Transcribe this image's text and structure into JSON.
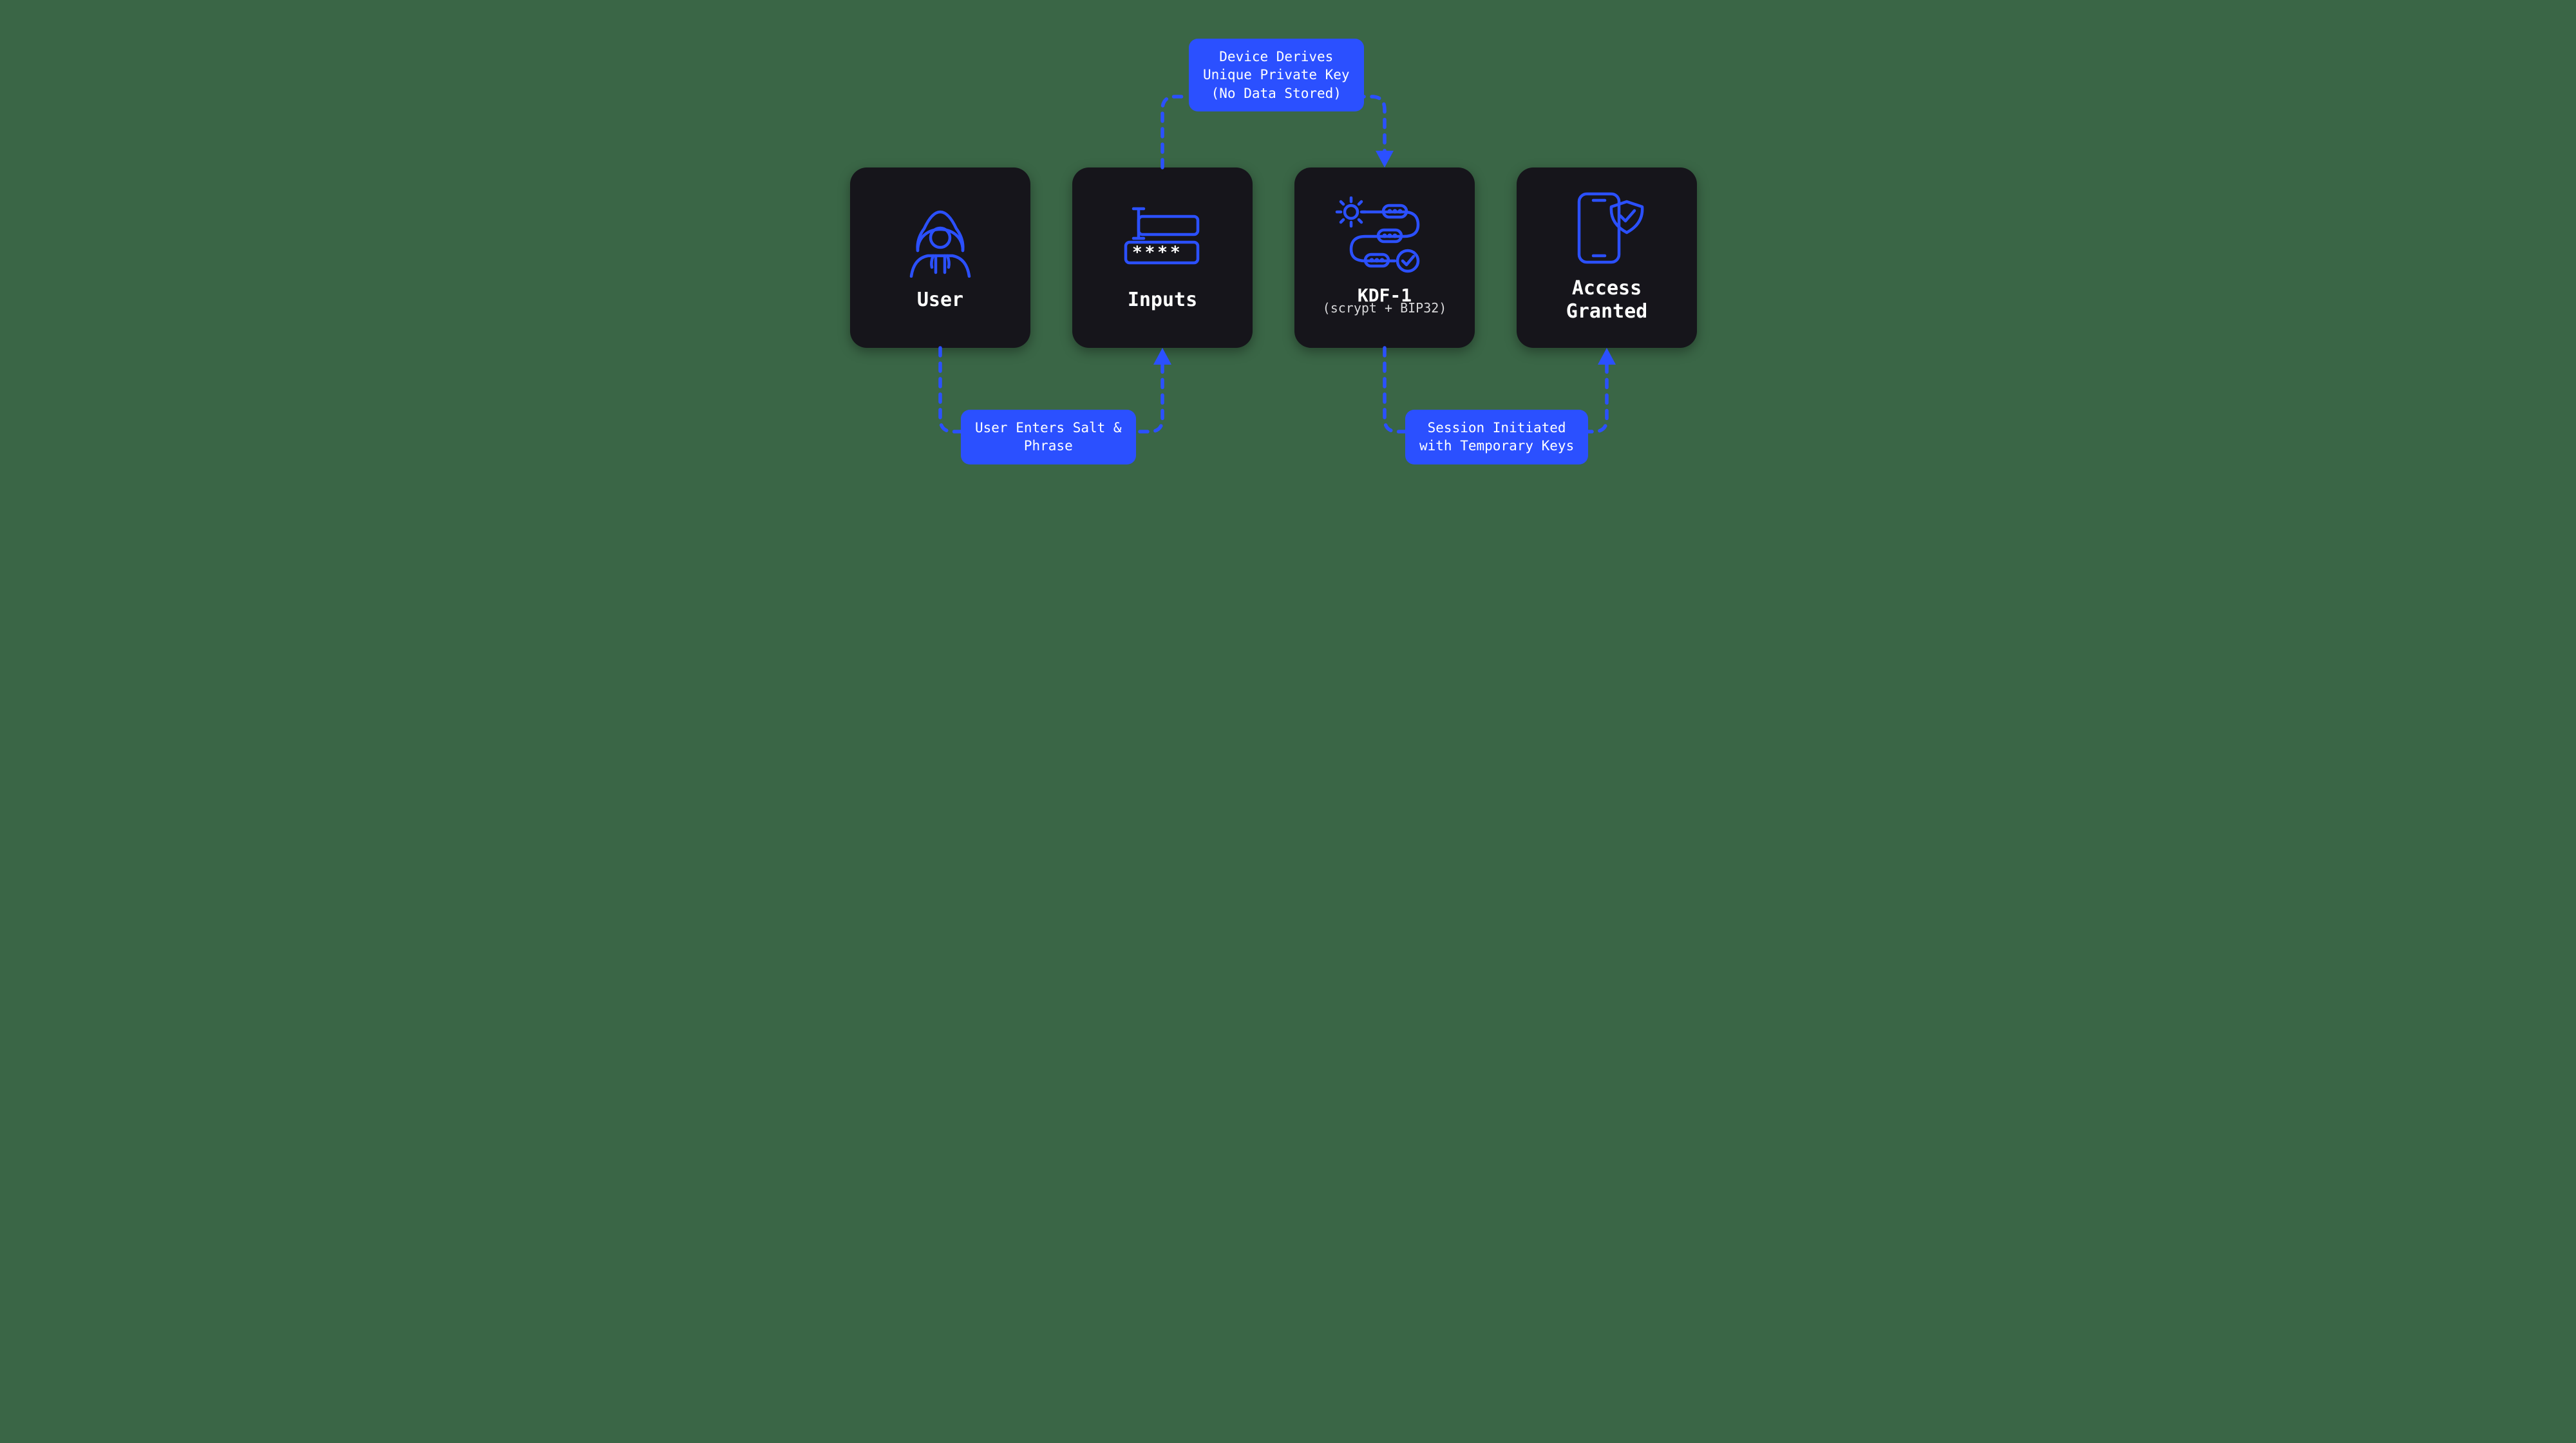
{
  "cards": {
    "user": {
      "title": "User"
    },
    "inputs": {
      "title": "Inputs",
      "password_mask": "****"
    },
    "kdf": {
      "title": "KDF-1",
      "subtitle": "(scrypt + BIP32)"
    },
    "access": {
      "title": "Access\nGranted"
    }
  },
  "labels": {
    "top": "Device Derives\nUnique Private Key\n(No Data Stored)",
    "bottom_left": "User Enters Salt &\nPhrase",
    "bottom_right": "Session Initiated\nwith Temporary Keys"
  },
  "colors": {
    "accent": "#2b50ff",
    "card_bg": "#16151b",
    "page_bg": "#3a6646"
  }
}
